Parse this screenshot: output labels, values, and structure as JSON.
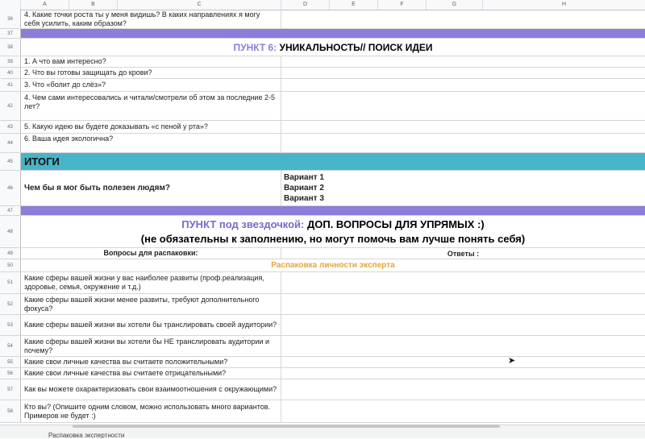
{
  "columns": [
    "A",
    "B",
    "C",
    "D",
    "E",
    "F",
    "G",
    "H"
  ],
  "rows": [
    {
      "num": "36",
      "text": "4. Какие точки роста ты у меня видишь? В каких направлениях я могу себя усилить, каким образом?"
    },
    {
      "num": "37",
      "text": ""
    },
    {
      "num": "38",
      "accent": "ПУНКТ 6:",
      "title": " УНИКАЛЬНОСТЬ// ПОИСК ИДЕИ"
    },
    {
      "num": "39",
      "text": "1. А что вам интересно?"
    },
    {
      "num": "40",
      "text": "2. Что вы готовы защищать до крови?"
    },
    {
      "num": "41",
      "text": "3. Что «болит до слёз»?"
    },
    {
      "num": "42",
      "text": "4. Чем сами интересовались и читали/смотрели об этом за последние 2-5 лет?"
    },
    {
      "num": "43",
      "text": "5. Какую идею вы будете доказывать «с пеной у рта»?"
    },
    {
      "num": "44",
      "text": "6. Ваша идея экологична?"
    },
    {
      "num": "45",
      "text": "ИТОГИ"
    },
    {
      "num": "46",
      "text": "Чем бы я мог быть полезен людям?",
      "v1": "Вариант 1",
      "v2": "Вариант 2",
      "v3": "Вариант 3"
    },
    {
      "num": "47",
      "text": ""
    },
    {
      "num": "48",
      "accent": "ПУНКТ под звездочкой:",
      "title": " ДОП. ВОПРОСЫ ДЛЯ УПРЯМЫХ :)",
      "line2": "(не обязательны к заполнению, но могут помочь вам лучше понять себя)"
    },
    {
      "num": "49",
      "left": "Вопросы для распаковки:",
      "right": "Ответы :"
    },
    {
      "num": "50",
      "text": "Распаковка личности эксперта"
    },
    {
      "num": "51",
      "text": "Какие сферы вашей жизни у вас наиболее развиты (проф.реализация, здоровье, семья, окружение и т.д.)"
    },
    {
      "num": "52",
      "text": "Какие сферы вашей жизни менее развиты, требуют дополнительного фокуса?"
    },
    {
      "num": "53",
      "text": "Какие сферы вашей жизни вы хотели бы транслировать своей аудитории?"
    },
    {
      "num": "54",
      "text": "Какие сферы вашей жизни вы хотели бы НЕ транслировать аудитории и почему?"
    },
    {
      "num": "55",
      "text": "Какие свои личные качества вы считаете положительными?"
    },
    {
      "num": "56",
      "text": "Какие свои личные качества вы считаете отрицательными?"
    },
    {
      "num": "57",
      "text": "Как вы можете охарактеризовать свои взаимоотношения с окружающими?"
    },
    {
      "num": "58",
      "text": "Кто вы? (Опишите одним словом, можно использовать много вариантов. Примеров не будет :)"
    }
  ],
  "sheet_tab": "Распаковка экспертности",
  "colors": {
    "purple": "#8e7cd9",
    "teal": "#48b4c8",
    "orange": "#e4a53a"
  }
}
